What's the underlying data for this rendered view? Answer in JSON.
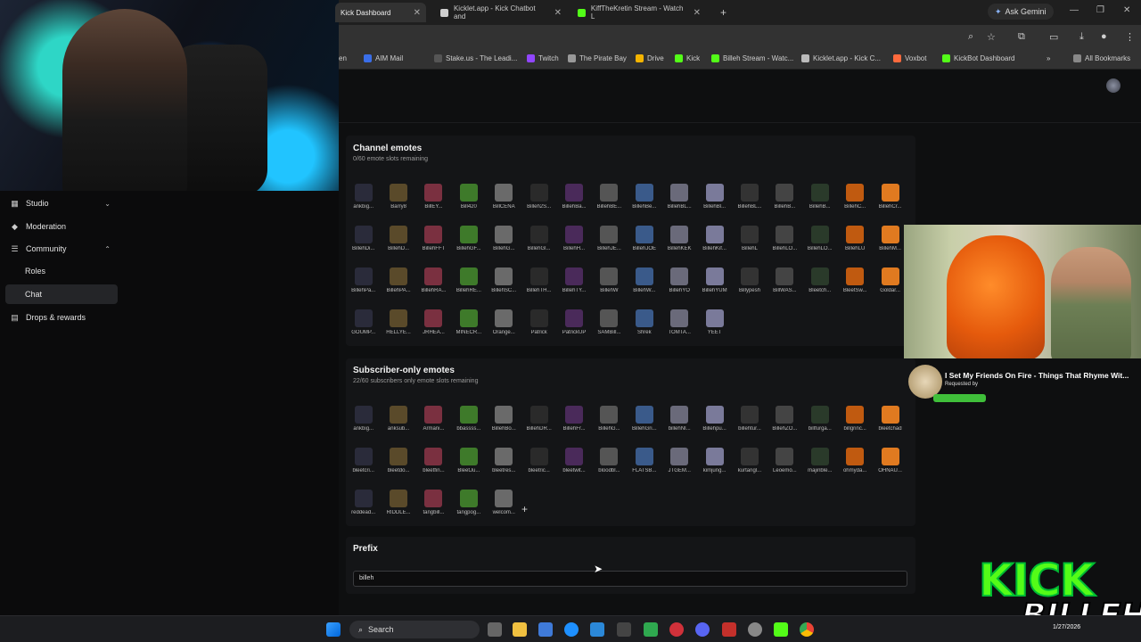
{
  "tabs": [
    {
      "label": "Kick Dashboard",
      "active": true
    },
    {
      "label": "Kicklet.app - Kick Chatbot and",
      "active": false
    },
    {
      "label": "KiffTheKretin Stream - Watch L",
      "active": false
    }
  ],
  "gemini_label": "Ask Gemini",
  "bookmarks": [
    "AIM Mail",
    "Stake.us - The Leadi...",
    "Twitch",
    "The Pirate Bay",
    "Drive",
    "Kick",
    "Billeh Stream - Watc...",
    "Kicklet.app - Kick C...",
    "Voxbot",
    "KickBot Dashboard"
  ],
  "bookmark_partial": "en",
  "all_bookmarks": "All Bookmarks",
  "sidebar": {
    "items": [
      {
        "label": "Studio",
        "icon": "studio-icon",
        "chevron": "down"
      },
      {
        "label": "Moderation",
        "icon": "moderation-icon"
      },
      {
        "label": "Community",
        "icon": "community-icon",
        "chevron": "up"
      },
      {
        "label": "Roles"
      },
      {
        "label": "Chat",
        "active": true
      },
      {
        "label": "Drops & rewards",
        "icon": "drops-icon"
      }
    ]
  },
  "channel_emotes": {
    "title": "Channel emotes",
    "subtitle": "0/60 emote slots remaining",
    "emotes": [
      "ankbig...",
      "Barry8",
      "BillEY...",
      "Bill420",
      "BillCENA",
      "Billeh2S...",
      "BillehBa...",
      "BillehBE...",
      "BillehBe...",
      "BillehBL...",
      "BillehBl...",
      "BillehBL...",
      "BillehB...",
      "BillehB...",
      "BillehC...",
      "BillehCr...",
      "BillehDi...",
      "BillehD...",
      "BillehFFT",
      "BillehGF...",
      "BillehG...",
      "BillehGl...",
      "BillehH...",
      "BillehJE...",
      "BillehJOE",
      "BillehKEK",
      "BillehKif...",
      "BillehL",
      "BillehLO...",
      "BillehLO...",
      "BillehLU",
      "BillehM...",
      "BillehPa...",
      "BillehPA...",
      "BillehRA...",
      "BillehRE...",
      "BillehSC...",
      "BillehTH...",
      "BillehTY...",
      "BillehW",
      "BillehW...",
      "BillehYO",
      "BillehYUM",
      "Billypesh",
      "BillWAS...",
      "Bleetch...",
      "BleetSw...",
      "Goldar...",
      "GOUMP...",
      "HELLYE...",
      "JRHEA...",
      "MINECR...",
      "Orange...",
      "Patrick",
      "PatrickUP",
      "SAMBill...",
      "Shrek",
      "TOMTA...",
      "YEET"
    ]
  },
  "subscriber_emotes": {
    "title": "Subscriber-only emotes",
    "subtitle": "22/60 subscribers only emote slots remaining",
    "emotes": [
      "ankbig...",
      "anksub...",
      "Armani...",
      "bbassss...",
      "BillehBo...",
      "BillehDR...",
      "BillehFr...",
      "BillehG...",
      "BillehGri...",
      "billehNI...",
      "Billehpu...",
      "billehtur...",
      "BillehZO...",
      "billfurga...",
      "billgrinc...",
      "bleetchad",
      "bleetcri...",
      "bleetdo...",
      "bleetfin...",
      "BleetJu...",
      "bleetres...",
      "bleetric...",
      "bleetwit...",
      "bloodbl...",
      "FLATSB...",
      "JTGEM...",
      "kimjung...",
      "kurtangl...",
      "Leoemo...",
      "majinble...",
      "ohmyda...",
      "OHNAU...",
      "reddead...",
      "RIDDLE...",
      "tangbill...",
      "tangpog...",
      "welcom..."
    ],
    "add_label": "+"
  },
  "prefix": {
    "title": "Prefix",
    "value": "billeh"
  },
  "overlay": {
    "song_title": "I Set My Friends On Fire - Things That Rhyme Wit...",
    "requested_by": "Requested by"
  },
  "kick_logo": {
    "word": "KICK",
    "name": "BILLEH"
  },
  "taskbar": {
    "search": "Search",
    "date": "1/27/2026"
  },
  "colors": {
    "kick_green": "#53fc18",
    "panel": "#141517",
    "background": "#0e0f10"
  }
}
